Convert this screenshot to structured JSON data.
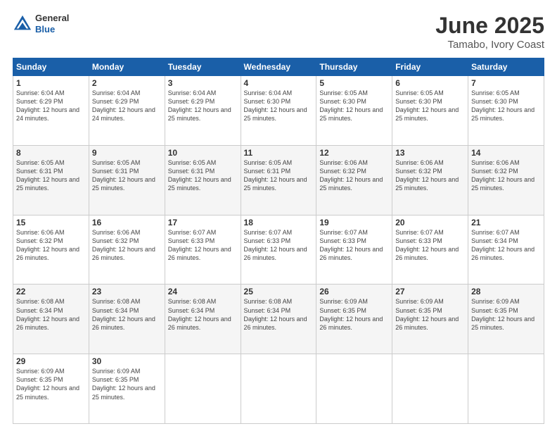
{
  "header": {
    "logo": {
      "general": "General",
      "blue": "Blue"
    },
    "title": "June 2025",
    "subtitle": "Tamabo, Ivory Coast"
  },
  "days_of_week": [
    "Sunday",
    "Monday",
    "Tuesday",
    "Wednesday",
    "Thursday",
    "Friday",
    "Saturday"
  ],
  "weeks": [
    [
      {
        "day": "1",
        "sunrise": "Sunrise: 6:04 AM",
        "sunset": "Sunset: 6:29 PM",
        "daylight": "Daylight: 12 hours and 24 minutes."
      },
      {
        "day": "2",
        "sunrise": "Sunrise: 6:04 AM",
        "sunset": "Sunset: 6:29 PM",
        "daylight": "Daylight: 12 hours and 24 minutes."
      },
      {
        "day": "3",
        "sunrise": "Sunrise: 6:04 AM",
        "sunset": "Sunset: 6:29 PM",
        "daylight": "Daylight: 12 hours and 25 minutes."
      },
      {
        "day": "4",
        "sunrise": "Sunrise: 6:04 AM",
        "sunset": "Sunset: 6:30 PM",
        "daylight": "Daylight: 12 hours and 25 minutes."
      },
      {
        "day": "5",
        "sunrise": "Sunrise: 6:05 AM",
        "sunset": "Sunset: 6:30 PM",
        "daylight": "Daylight: 12 hours and 25 minutes."
      },
      {
        "day": "6",
        "sunrise": "Sunrise: 6:05 AM",
        "sunset": "Sunset: 6:30 PM",
        "daylight": "Daylight: 12 hours and 25 minutes."
      },
      {
        "day": "7",
        "sunrise": "Sunrise: 6:05 AM",
        "sunset": "Sunset: 6:30 PM",
        "daylight": "Daylight: 12 hours and 25 minutes."
      }
    ],
    [
      {
        "day": "8",
        "sunrise": "Sunrise: 6:05 AM",
        "sunset": "Sunset: 6:31 PM",
        "daylight": "Daylight: 12 hours and 25 minutes."
      },
      {
        "day": "9",
        "sunrise": "Sunrise: 6:05 AM",
        "sunset": "Sunset: 6:31 PM",
        "daylight": "Daylight: 12 hours and 25 minutes."
      },
      {
        "day": "10",
        "sunrise": "Sunrise: 6:05 AM",
        "sunset": "Sunset: 6:31 PM",
        "daylight": "Daylight: 12 hours and 25 minutes."
      },
      {
        "day": "11",
        "sunrise": "Sunrise: 6:05 AM",
        "sunset": "Sunset: 6:31 PM",
        "daylight": "Daylight: 12 hours and 25 minutes."
      },
      {
        "day": "12",
        "sunrise": "Sunrise: 6:06 AM",
        "sunset": "Sunset: 6:32 PM",
        "daylight": "Daylight: 12 hours and 25 minutes."
      },
      {
        "day": "13",
        "sunrise": "Sunrise: 6:06 AM",
        "sunset": "Sunset: 6:32 PM",
        "daylight": "Daylight: 12 hours and 25 minutes."
      },
      {
        "day": "14",
        "sunrise": "Sunrise: 6:06 AM",
        "sunset": "Sunset: 6:32 PM",
        "daylight": "Daylight: 12 hours and 25 minutes."
      }
    ],
    [
      {
        "day": "15",
        "sunrise": "Sunrise: 6:06 AM",
        "sunset": "Sunset: 6:32 PM",
        "daylight": "Daylight: 12 hours and 26 minutes."
      },
      {
        "day": "16",
        "sunrise": "Sunrise: 6:06 AM",
        "sunset": "Sunset: 6:32 PM",
        "daylight": "Daylight: 12 hours and 26 minutes."
      },
      {
        "day": "17",
        "sunrise": "Sunrise: 6:07 AM",
        "sunset": "Sunset: 6:33 PM",
        "daylight": "Daylight: 12 hours and 26 minutes."
      },
      {
        "day": "18",
        "sunrise": "Sunrise: 6:07 AM",
        "sunset": "Sunset: 6:33 PM",
        "daylight": "Daylight: 12 hours and 26 minutes."
      },
      {
        "day": "19",
        "sunrise": "Sunrise: 6:07 AM",
        "sunset": "Sunset: 6:33 PM",
        "daylight": "Daylight: 12 hours and 26 minutes."
      },
      {
        "day": "20",
        "sunrise": "Sunrise: 6:07 AM",
        "sunset": "Sunset: 6:33 PM",
        "daylight": "Daylight: 12 hours and 26 minutes."
      },
      {
        "day": "21",
        "sunrise": "Sunrise: 6:07 AM",
        "sunset": "Sunset: 6:34 PM",
        "daylight": "Daylight: 12 hours and 26 minutes."
      }
    ],
    [
      {
        "day": "22",
        "sunrise": "Sunrise: 6:08 AM",
        "sunset": "Sunset: 6:34 PM",
        "daylight": "Daylight: 12 hours and 26 minutes."
      },
      {
        "day": "23",
        "sunrise": "Sunrise: 6:08 AM",
        "sunset": "Sunset: 6:34 PM",
        "daylight": "Daylight: 12 hours and 26 minutes."
      },
      {
        "day": "24",
        "sunrise": "Sunrise: 6:08 AM",
        "sunset": "Sunset: 6:34 PM",
        "daylight": "Daylight: 12 hours and 26 minutes."
      },
      {
        "day": "25",
        "sunrise": "Sunrise: 6:08 AM",
        "sunset": "Sunset: 6:34 PM",
        "daylight": "Daylight: 12 hours and 26 minutes."
      },
      {
        "day": "26",
        "sunrise": "Sunrise: 6:09 AM",
        "sunset": "Sunset: 6:35 PM",
        "daylight": "Daylight: 12 hours and 26 minutes."
      },
      {
        "day": "27",
        "sunrise": "Sunrise: 6:09 AM",
        "sunset": "Sunset: 6:35 PM",
        "daylight": "Daylight: 12 hours and 26 minutes."
      },
      {
        "day": "28",
        "sunrise": "Sunrise: 6:09 AM",
        "sunset": "Sunset: 6:35 PM",
        "daylight": "Daylight: 12 hours and 25 minutes."
      }
    ],
    [
      {
        "day": "29",
        "sunrise": "Sunrise: 6:09 AM",
        "sunset": "Sunset: 6:35 PM",
        "daylight": "Daylight: 12 hours and 25 minutes."
      },
      {
        "day": "30",
        "sunrise": "Sunrise: 6:09 AM",
        "sunset": "Sunset: 6:35 PM",
        "daylight": "Daylight: 12 hours and 25 minutes."
      },
      null,
      null,
      null,
      null,
      null
    ]
  ]
}
